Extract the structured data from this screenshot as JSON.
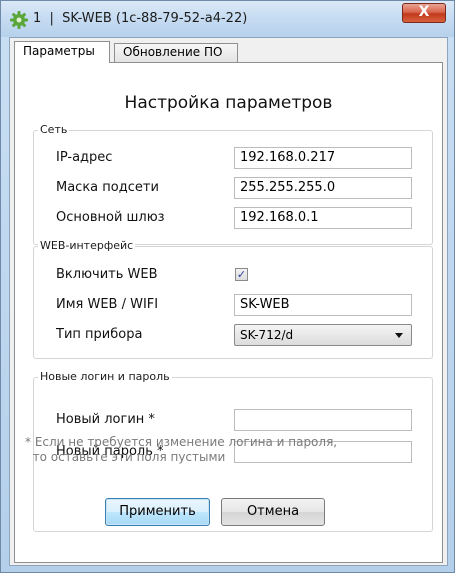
{
  "window": {
    "title": "1  |  SK-WEB (1c-88-79-52-a4-22)",
    "close_label": "X"
  },
  "tabs": [
    {
      "label": "Параметры"
    },
    {
      "label": "Обновление ПО"
    }
  ],
  "heading": "Настройка параметров",
  "network": {
    "group_label": "Сеть",
    "ip_label": "IP-адрес",
    "ip_value": "192.168.0.217",
    "mask_label": "Маска подсети",
    "mask_value": "255.255.255.0",
    "gateway_label": "Основной шлюз",
    "gateway_value": "192.168.0.1"
  },
  "web": {
    "group_label": "WEB-интерфейс",
    "enable_label": "Включить WEB",
    "enable_checked": true,
    "enable_check_glyph": "✓",
    "name_label": "Имя WEB / WIFI",
    "name_value": "SK-WEB",
    "device_label": "Тип прибора",
    "device_value": "SK-712/d"
  },
  "credentials": {
    "group_label": "Новые логин и пароль",
    "login_label": "Новый логин *",
    "login_value": "",
    "password_label": "Новый пароль *",
    "password_value": ""
  },
  "note": "* Если не требуется изменение логина и пароля,\n  то оставьте эти поля пустыми",
  "buttons": {
    "apply": "Применить",
    "cancel": "Отмена"
  },
  "colors": {
    "titlebar": "#c5dbf1",
    "close_button": "#c1391c",
    "primary_button_border": "#3c7fb1"
  }
}
